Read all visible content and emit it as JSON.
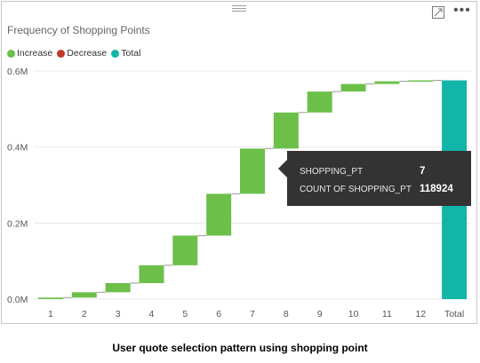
{
  "visual": {
    "title": "Frequency of Shopping Points",
    "legend": [
      {
        "label": "Increase",
        "color": "#6cc04a"
      },
      {
        "label": "Decrease",
        "color": "#c0392b"
      },
      {
        "label": "Total",
        "color": "#1abc9c"
      }
    ],
    "icons": {
      "drag": "drag-handle-icon",
      "focus": "focus-mode-icon",
      "more": "more-options-icon"
    },
    "more_symbol": "•••"
  },
  "chart_data": {
    "type": "waterfall",
    "title": "Frequency of Shopping Points",
    "categories": [
      "1",
      "2",
      "3",
      "4",
      "5",
      "6",
      "7",
      "8",
      "9",
      "10",
      "11",
      "12",
      "Total"
    ],
    "increments": [
      4000,
      14000,
      24000,
      47000,
      78000,
      110000,
      118924,
      95000,
      55000,
      20000,
      7000,
      2500,
      0
    ],
    "total": 575424,
    "ylim": [
      0,
      600000
    ],
    "yticks": [
      0,
      200000,
      400000,
      600000
    ],
    "ytick_labels": [
      "0.0M",
      "0.2M",
      "0.4M",
      "0.6M"
    ],
    "colors": {
      "increase": "#6cc04a",
      "decrease": "#c0392b",
      "total": "#12b5a8"
    },
    "grid": true
  },
  "tooltip": {
    "rows": [
      {
        "key": "SHOPPING_PT",
        "value": "7"
      },
      {
        "key": "COUNT OF SHOPPING_PT",
        "value": "118924"
      }
    ]
  },
  "caption": "User quote selection pattern using shopping point"
}
